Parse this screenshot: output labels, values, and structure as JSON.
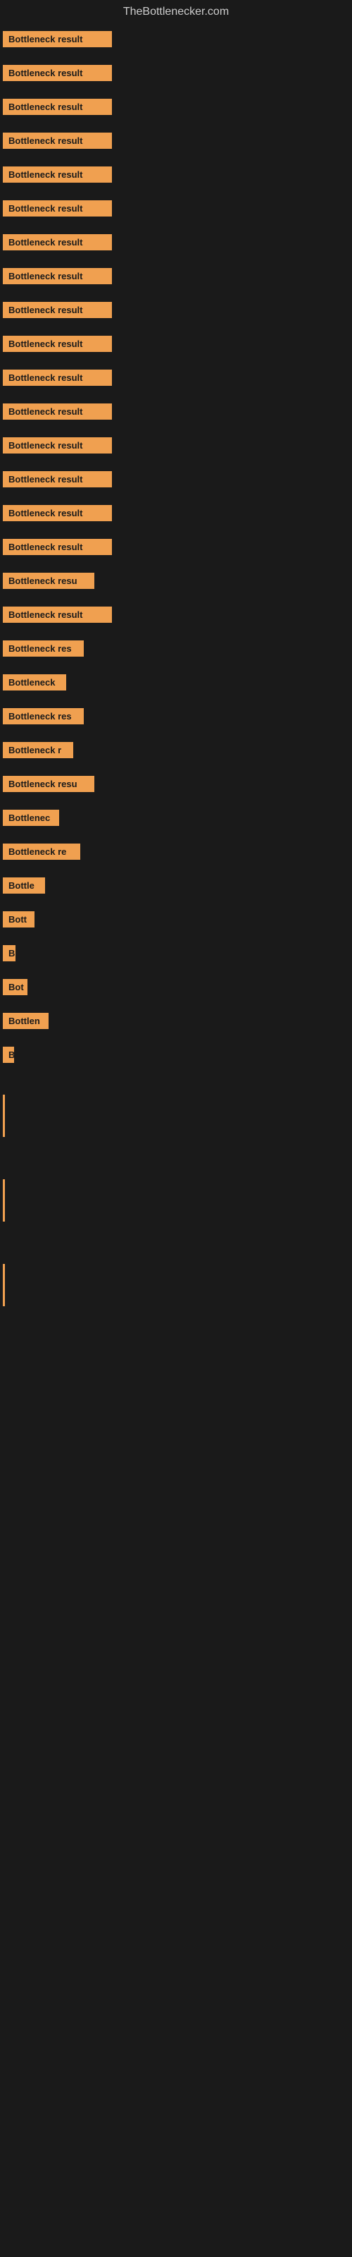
{
  "site": {
    "title": "TheBottlenecker.com"
  },
  "bars": [
    {
      "label": "Bottleneck result",
      "width": 155
    },
    {
      "label": "Bottleneck result",
      "width": 155
    },
    {
      "label": "Bottleneck result",
      "width": 155
    },
    {
      "label": "Bottleneck result",
      "width": 155
    },
    {
      "label": "Bottleneck result",
      "width": 155
    },
    {
      "label": "Bottleneck result",
      "width": 155
    },
    {
      "label": "Bottleneck result",
      "width": 155
    },
    {
      "label": "Bottleneck result",
      "width": 155
    },
    {
      "label": "Bottleneck result",
      "width": 155
    },
    {
      "label": "Bottleneck result",
      "width": 155
    },
    {
      "label": "Bottleneck result",
      "width": 155
    },
    {
      "label": "Bottleneck result",
      "width": 155
    },
    {
      "label": "Bottleneck result",
      "width": 155
    },
    {
      "label": "Bottleneck result",
      "width": 155
    },
    {
      "label": "Bottleneck result",
      "width": 155
    },
    {
      "label": "Bottleneck result",
      "width": 155
    },
    {
      "label": "Bottleneck resu",
      "width": 130
    },
    {
      "label": "Bottleneck result",
      "width": 155
    },
    {
      "label": "Bottleneck res",
      "width": 115
    },
    {
      "label": "Bottleneck",
      "width": 90
    },
    {
      "label": "Bottleneck res",
      "width": 115
    },
    {
      "label": "Bottleneck r",
      "width": 100
    },
    {
      "label": "Bottleneck resu",
      "width": 130
    },
    {
      "label": "Bottlenec",
      "width": 80
    },
    {
      "label": "Bottleneck re",
      "width": 110
    },
    {
      "label": "Bottle",
      "width": 60
    },
    {
      "label": "Bott",
      "width": 45
    },
    {
      "label": "B",
      "width": 18
    },
    {
      "label": "Bot",
      "width": 35
    },
    {
      "label": "Bottlen",
      "width": 65
    },
    {
      "label": "B",
      "width": 15
    }
  ],
  "vertical_lines": [
    {
      "height": 60
    },
    {
      "height": 60
    },
    {
      "height": 60
    }
  ]
}
